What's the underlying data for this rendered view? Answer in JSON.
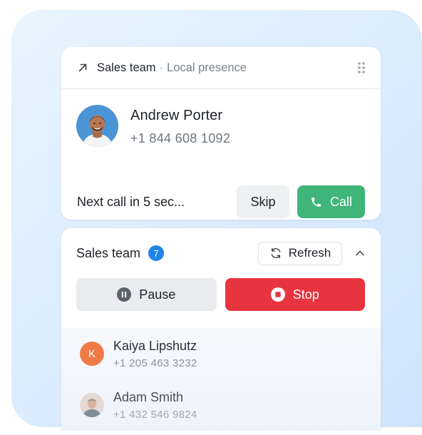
{
  "dialer": {
    "team": "Sales team",
    "separator": "·",
    "presence": "Local presence",
    "contact": {
      "name": "Andrew Porter",
      "phone": "+1 844 608 1092"
    },
    "next_call_text": "Next call in 5 sec...",
    "skip_label": "Skip",
    "call_label": "Call"
  },
  "queue": {
    "title": "Sales team",
    "count": "7",
    "refresh_label": "Refresh",
    "pause_label": "Pause",
    "stop_label": "Stop",
    "contacts": [
      {
        "initial": "K",
        "name": "Kaiya Lipshutz",
        "phone": "+1 205 463 3232"
      },
      {
        "initial": "",
        "name": "Adam Smith",
        "phone": "+1 432 546 9824"
      }
    ]
  },
  "colors": {
    "call_green": "#3fb57a",
    "stop_red": "#e8343f",
    "badge_blue": "#2185e8",
    "avatar_orange": "#f07a46"
  },
  "icons": [
    "arrow-up-right-icon",
    "drag-grip-icon",
    "phone-icon",
    "refresh-icon",
    "chevron-up-icon",
    "pause-icon",
    "stop-icon"
  ]
}
